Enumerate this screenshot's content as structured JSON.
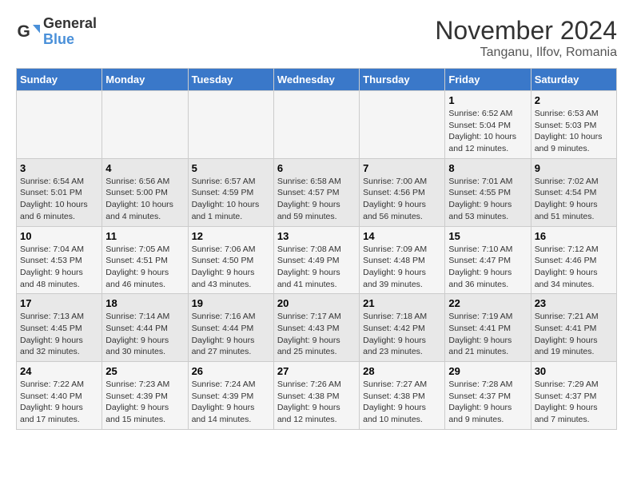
{
  "logo": {
    "text1": "General",
    "text2": "Blue"
  },
  "title": "November 2024",
  "subtitle": "Tanganu, Ilfov, Romania",
  "weekdays": [
    "Sunday",
    "Monday",
    "Tuesday",
    "Wednesday",
    "Thursday",
    "Friday",
    "Saturday"
  ],
  "rows": [
    [
      {
        "day": "",
        "info": ""
      },
      {
        "day": "",
        "info": ""
      },
      {
        "day": "",
        "info": ""
      },
      {
        "day": "",
        "info": ""
      },
      {
        "day": "",
        "info": ""
      },
      {
        "day": "1",
        "info": "Sunrise: 6:52 AM\nSunset: 5:04 PM\nDaylight: 10 hours and 12 minutes."
      },
      {
        "day": "2",
        "info": "Sunrise: 6:53 AM\nSunset: 5:03 PM\nDaylight: 10 hours and 9 minutes."
      }
    ],
    [
      {
        "day": "3",
        "info": "Sunrise: 6:54 AM\nSunset: 5:01 PM\nDaylight: 10 hours and 6 minutes."
      },
      {
        "day": "4",
        "info": "Sunrise: 6:56 AM\nSunset: 5:00 PM\nDaylight: 10 hours and 4 minutes."
      },
      {
        "day": "5",
        "info": "Sunrise: 6:57 AM\nSunset: 4:59 PM\nDaylight: 10 hours and 1 minute."
      },
      {
        "day": "6",
        "info": "Sunrise: 6:58 AM\nSunset: 4:57 PM\nDaylight: 9 hours and 59 minutes."
      },
      {
        "day": "7",
        "info": "Sunrise: 7:00 AM\nSunset: 4:56 PM\nDaylight: 9 hours and 56 minutes."
      },
      {
        "day": "8",
        "info": "Sunrise: 7:01 AM\nSunset: 4:55 PM\nDaylight: 9 hours and 53 minutes."
      },
      {
        "day": "9",
        "info": "Sunrise: 7:02 AM\nSunset: 4:54 PM\nDaylight: 9 hours and 51 minutes."
      }
    ],
    [
      {
        "day": "10",
        "info": "Sunrise: 7:04 AM\nSunset: 4:53 PM\nDaylight: 9 hours and 48 minutes."
      },
      {
        "day": "11",
        "info": "Sunrise: 7:05 AM\nSunset: 4:51 PM\nDaylight: 9 hours and 46 minutes."
      },
      {
        "day": "12",
        "info": "Sunrise: 7:06 AM\nSunset: 4:50 PM\nDaylight: 9 hours and 43 minutes."
      },
      {
        "day": "13",
        "info": "Sunrise: 7:08 AM\nSunset: 4:49 PM\nDaylight: 9 hours and 41 minutes."
      },
      {
        "day": "14",
        "info": "Sunrise: 7:09 AM\nSunset: 4:48 PM\nDaylight: 9 hours and 39 minutes."
      },
      {
        "day": "15",
        "info": "Sunrise: 7:10 AM\nSunset: 4:47 PM\nDaylight: 9 hours and 36 minutes."
      },
      {
        "day": "16",
        "info": "Sunrise: 7:12 AM\nSunset: 4:46 PM\nDaylight: 9 hours and 34 minutes."
      }
    ],
    [
      {
        "day": "17",
        "info": "Sunrise: 7:13 AM\nSunset: 4:45 PM\nDaylight: 9 hours and 32 minutes."
      },
      {
        "day": "18",
        "info": "Sunrise: 7:14 AM\nSunset: 4:44 PM\nDaylight: 9 hours and 30 minutes."
      },
      {
        "day": "19",
        "info": "Sunrise: 7:16 AM\nSunset: 4:44 PM\nDaylight: 9 hours and 27 minutes."
      },
      {
        "day": "20",
        "info": "Sunrise: 7:17 AM\nSunset: 4:43 PM\nDaylight: 9 hours and 25 minutes."
      },
      {
        "day": "21",
        "info": "Sunrise: 7:18 AM\nSunset: 4:42 PM\nDaylight: 9 hours and 23 minutes."
      },
      {
        "day": "22",
        "info": "Sunrise: 7:19 AM\nSunset: 4:41 PM\nDaylight: 9 hours and 21 minutes."
      },
      {
        "day": "23",
        "info": "Sunrise: 7:21 AM\nSunset: 4:41 PM\nDaylight: 9 hours and 19 minutes."
      }
    ],
    [
      {
        "day": "24",
        "info": "Sunrise: 7:22 AM\nSunset: 4:40 PM\nDaylight: 9 hours and 17 minutes."
      },
      {
        "day": "25",
        "info": "Sunrise: 7:23 AM\nSunset: 4:39 PM\nDaylight: 9 hours and 15 minutes."
      },
      {
        "day": "26",
        "info": "Sunrise: 7:24 AM\nSunset: 4:39 PM\nDaylight: 9 hours and 14 minutes."
      },
      {
        "day": "27",
        "info": "Sunrise: 7:26 AM\nSunset: 4:38 PM\nDaylight: 9 hours and 12 minutes."
      },
      {
        "day": "28",
        "info": "Sunrise: 7:27 AM\nSunset: 4:38 PM\nDaylight: 9 hours and 10 minutes."
      },
      {
        "day": "29",
        "info": "Sunrise: 7:28 AM\nSunset: 4:37 PM\nDaylight: 9 hours and 9 minutes."
      },
      {
        "day": "30",
        "info": "Sunrise: 7:29 AM\nSunset: 4:37 PM\nDaylight: 9 hours and 7 minutes."
      }
    ]
  ]
}
